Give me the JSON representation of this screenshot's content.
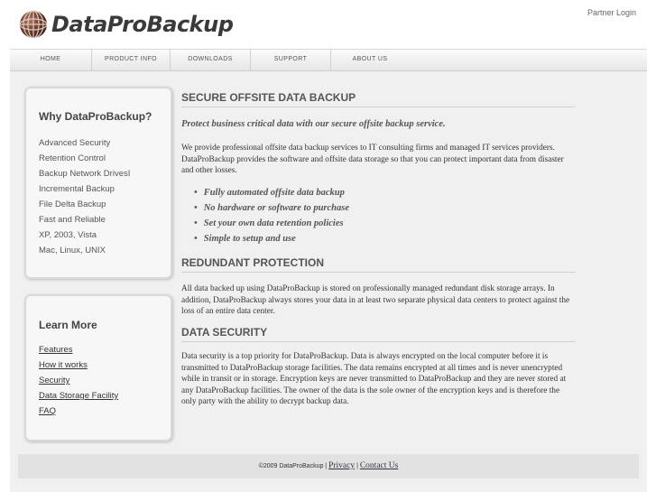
{
  "header": {
    "logo_text": "DataProBackup",
    "partner_login": "Partner Login"
  },
  "nav": [
    {
      "label": "HOME",
      "name": "nav-home"
    },
    {
      "label": "PRODUCT INFO",
      "name": "nav-product-info"
    },
    {
      "label": "DOWNLOADS",
      "name": "nav-downloads"
    },
    {
      "label": "SUPPORT",
      "name": "nav-support"
    },
    {
      "label": "ABOUT US",
      "name": "nav-about-us"
    }
  ],
  "why_box": {
    "title": "Why DataProBackup?",
    "items": [
      "Advanced Security",
      "Retention Control",
      "Backup Network DrivesI",
      "Incremental Backup",
      "File Delta Backup",
      "Fast and Reliable",
      "XP, 2003, Vista",
      "Mac, Linux, UNIX"
    ]
  },
  "learn_box": {
    "title": "Learn More",
    "links": [
      "Features",
      "How it works",
      "Security",
      "Data Storage Facility",
      "FAQ"
    ]
  },
  "main": {
    "heading1": "SECURE OFFSITE DATA BACKUP",
    "tagline": "Protect business critical data with our secure offsite backup service.",
    "intro": "We provide professional offsite data backup services to IT consulting firms and managed IT services providers. DataProBackup provides the software and offsite data storage so that you can protect important data from disaster and other losses.",
    "bullets": [
      "Fully automated offsite data backup",
      "No hardware or software to purchase",
      "Set your own data retention policies",
      "Simple to setup and use"
    ],
    "heading2": "REDUNDANT PROTECTION",
    "redundant": "All data backed up using DataProBackup is stored on professionally managed redundant disk storage arrays. In addition, DataProBackup always stores your data in at least two separate physical data centers to protect against the loss of an entire data center.",
    "heading3": "DATA SECURITY",
    "security": "Data security is a top priority for DataProBackup. Data is always encrypted on the local computer before it is transmitted to DataProBackup storage facilities. The data remains encrypted at all times and is never unencrypted while in transit or in storage. Encryption keys are never transmitted to DataProBackup and they are never stored at any DataProBackup facilities. The owner of the data is the sole owner of the encryption keys and is therefore the only party with the ability to decrypt backup data."
  },
  "footer": {
    "copyright": "©2009 DataProBackup |",
    "privacy": "Privacy",
    "separator": "|",
    "contact": "Contact Us"
  }
}
